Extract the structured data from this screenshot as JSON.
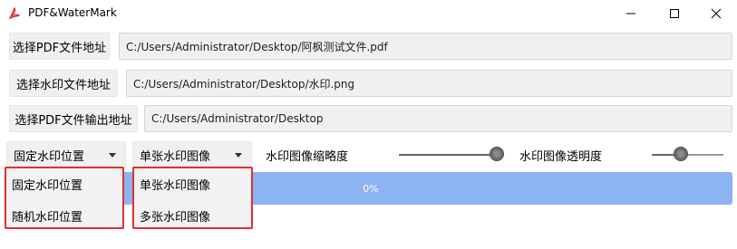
{
  "window": {
    "title": "PDF&WaterMark",
    "icon": "pdf-icon",
    "controls": [
      "minimize-icon",
      "maximize-icon",
      "close-icon"
    ]
  },
  "rows": [
    {
      "button_label": "选择PDF文件地址",
      "path": "C:/Users/Administrator/Desktop/阿枫测试文件.pdf"
    },
    {
      "button_label": "选择水印文件地址",
      "path": "C:/Users/Administrator/Desktop/水印.png"
    },
    {
      "button_label": "选择PDF文件输出地址",
      "path": "C:/Users/Administrator/Desktop"
    }
  ],
  "position_combo": {
    "selected": "固定水印位置",
    "options": [
      "固定水印位置",
      "随机水印位置"
    ]
  },
  "image_combo": {
    "selected": "单张水印图像",
    "options": [
      "单张水印图像",
      "多张水印图像"
    ]
  },
  "scale_slider": {
    "label": "水印图像缩略度",
    "value": 1.0
  },
  "opacity_slider": {
    "label": "水印图像透明度",
    "value": 0.4
  },
  "progress": {
    "text": "0%",
    "value": 0
  },
  "colors": {
    "progress_bar": "#8cb3f2",
    "highlight_border": "#e03030"
  }
}
